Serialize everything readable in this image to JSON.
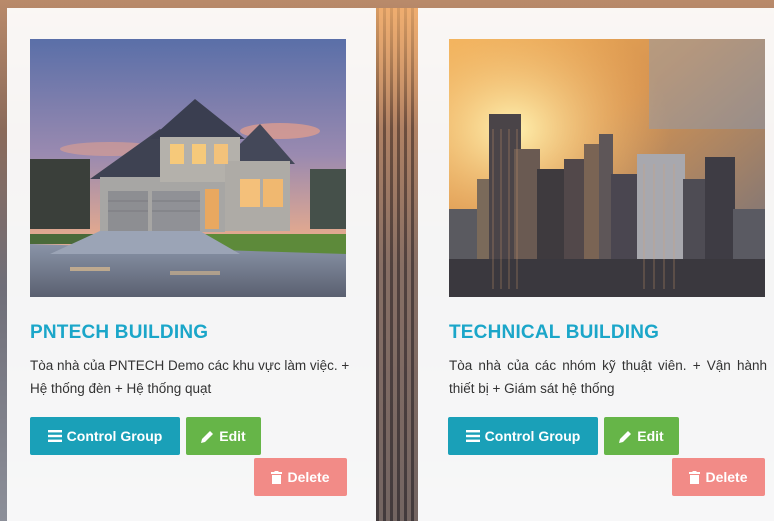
{
  "cards": [
    {
      "title": "PNTECH BUILDING",
      "description": "Tòa nhà của PNTECH Demo các khu vực làm việc. + Hệ thống đèn + Hệ thống quạt",
      "image": "house-photo",
      "buttons": {
        "control": "Control Group",
        "edit": "Edit",
        "delete": "Delete"
      }
    },
    {
      "title": "TECHNICAL BUILDING",
      "description": "Tòa nhà của các nhóm kỹ thuật viên. + Vận hành thiết bị + Giám sát hệ thống",
      "image": "city-skyline-photo",
      "buttons": {
        "control": "Control Group",
        "edit": "Edit",
        "delete": "Delete"
      }
    }
  ],
  "icons": {
    "control": "list-icon",
    "edit": "pencil-icon",
    "delete": "trash-icon"
  },
  "colors": {
    "title": "#1ba6c9",
    "control_button": "#1aa0b8",
    "edit_button": "#66b548",
    "delete_button": "#f28b87"
  }
}
